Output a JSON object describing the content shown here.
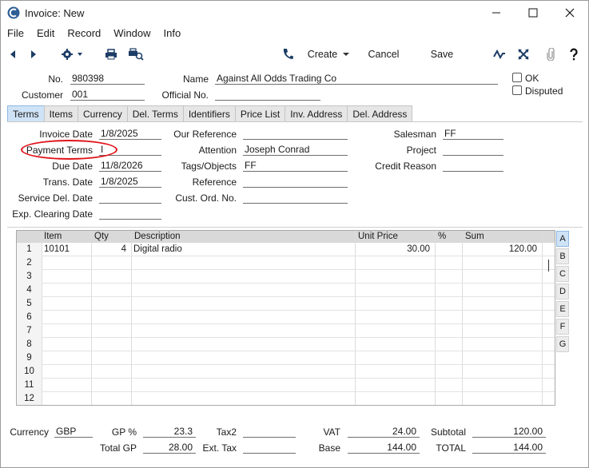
{
  "window": {
    "title": "Invoice: New"
  },
  "menu": [
    "File",
    "Edit",
    "Record",
    "Window",
    "Info"
  ],
  "toolbar": {
    "create": "Create",
    "cancel": "Cancel",
    "save": "Save"
  },
  "header": {
    "no_label": "No.",
    "no": "980398",
    "customer_label": "Customer",
    "customer": "001",
    "name_label": "Name",
    "name": "Against All Odds Trading Co",
    "official_no_label": "Official No.",
    "official_no": "",
    "ok_label": "OK",
    "disputed_label": "Disputed"
  },
  "tabs": [
    "Terms",
    "Items",
    "Currency",
    "Del. Terms",
    "Identifiers",
    "Price List",
    "Inv. Address",
    "Del. Address"
  ],
  "terms": {
    "invoice_date_label": "Invoice Date",
    "invoice_date": "1/8/2025",
    "payment_terms_label": "Payment Terms",
    "payment_terms": "I",
    "due_date_label": "Due Date",
    "due_date": "11/8/2026",
    "trans_date_label": "Trans. Date",
    "trans_date": "1/8/2025",
    "service_del_date_label": "Service Del. Date",
    "service_del_date": "",
    "exp_clearing_date_label": "Exp. Clearing Date",
    "exp_clearing_date": "",
    "our_reference_label": "Our Reference",
    "our_reference": "",
    "attention_label": "Attention",
    "attention": "Joseph Conrad",
    "tags_label": "Tags/Objects",
    "tags": "FF",
    "reference_label": "Reference",
    "reference": "",
    "cust_ord_no_label": "Cust. Ord. No.",
    "cust_ord_no": "",
    "salesman_label": "Salesman",
    "salesman": "FF",
    "project_label": "Project",
    "project": "",
    "credit_reason_label": "Credit Reason",
    "credit_reason": ""
  },
  "grid": {
    "headers": {
      "item": "Item",
      "qty": "Qty",
      "description": "Description",
      "unit_price": "Unit Price",
      "pct": "%",
      "sum": "Sum"
    },
    "rows": [
      {
        "n": "1",
        "item": "10101",
        "qty": "4",
        "description": "Digital radio",
        "unit_price": "30.00",
        "pct": "",
        "sum": "120.00"
      },
      {
        "n": "2",
        "item": "",
        "qty": "",
        "description": "",
        "unit_price": "",
        "pct": "",
        "sum": ""
      },
      {
        "n": "3",
        "item": "",
        "qty": "",
        "description": "",
        "unit_price": "",
        "pct": "",
        "sum": ""
      },
      {
        "n": "4",
        "item": "",
        "qty": "",
        "description": "",
        "unit_price": "",
        "pct": "",
        "sum": ""
      },
      {
        "n": "5",
        "item": "",
        "qty": "",
        "description": "",
        "unit_price": "",
        "pct": "",
        "sum": ""
      },
      {
        "n": "6",
        "item": "",
        "qty": "",
        "description": "",
        "unit_price": "",
        "pct": "",
        "sum": ""
      },
      {
        "n": "7",
        "item": "",
        "qty": "",
        "description": "",
        "unit_price": "",
        "pct": "",
        "sum": ""
      },
      {
        "n": "8",
        "item": "",
        "qty": "",
        "description": "",
        "unit_price": "",
        "pct": "",
        "sum": ""
      },
      {
        "n": "9",
        "item": "",
        "qty": "",
        "description": "",
        "unit_price": "",
        "pct": "",
        "sum": ""
      },
      {
        "n": "10",
        "item": "",
        "qty": "",
        "description": "",
        "unit_price": "",
        "pct": "",
        "sum": ""
      },
      {
        "n": "11",
        "item": "",
        "qty": "",
        "description": "",
        "unit_price": "",
        "pct": "",
        "sum": ""
      },
      {
        "n": "12",
        "item": "",
        "qty": "",
        "description": "",
        "unit_price": "",
        "pct": "",
        "sum": ""
      }
    ],
    "side_tabs": [
      "A",
      "B",
      "C",
      "D",
      "E",
      "F",
      "G"
    ]
  },
  "footer": {
    "currency_label": "Currency",
    "currency": "GBP",
    "gp_pct_label": "GP %",
    "gp_pct": "23.3",
    "total_gp_label": "Total GP",
    "total_gp": "28.00",
    "tax2_label": "Tax2",
    "tax2": "",
    "ext_tax_label": "Ext. Tax",
    "ext_tax": "",
    "vat_label": "VAT",
    "vat": "24.00",
    "base_label": "Base",
    "base": "144.00",
    "subtotal_label": "Subtotal",
    "subtotal": "120.00",
    "total_label": "TOTAL",
    "total": "144.00"
  },
  "colors": {
    "highlight_oval": "#e0141b",
    "active_tab": "#cfe3f7"
  }
}
